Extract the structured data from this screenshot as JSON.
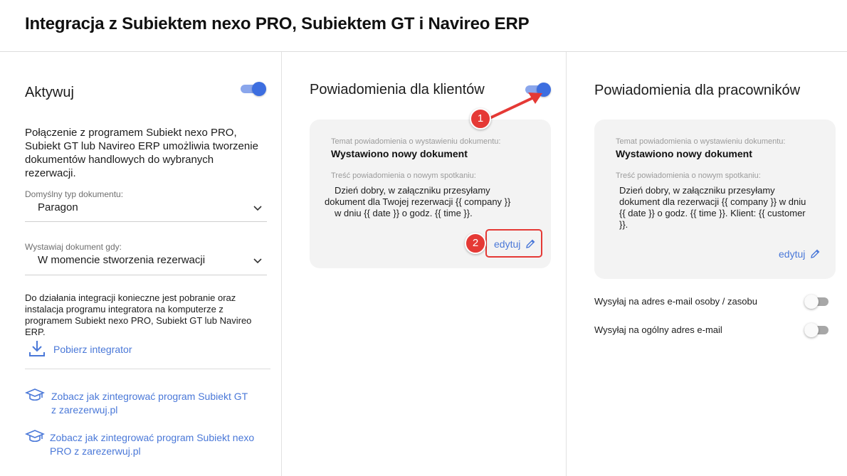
{
  "header": {
    "title": "Integracja z Subiektem nexo PRO, Subiektem GT i Navireo ERP"
  },
  "activate": {
    "title": "Aktywuj",
    "description": "Połączenie z programem Subiekt nexo PRO, Subiekt GT lub Navireo ERP umożliwia tworzenie dokumentów handlowych do wybranych rezerwacji.",
    "doc_type_label": "Domyślny typ dokumentu:",
    "doc_type_value": "Paragon",
    "issue_when_label": "Wystawiaj dokument gdy:",
    "issue_when_value": "W momencie stworzenia rezerwacji",
    "note": "Do działania integracji konieczne jest pobranie oraz instalacja programu integratora na komputerze z programem Subiekt nexo PRO, Subiekt GT lub Navireo ERP.",
    "download_label": "Pobierz integrator",
    "link_gt_line1": "Zobacz jak zintegrować program Subiekt GT",
    "link_gt_line2": "z zarezerwuj.pl",
    "link_nexo_line1": "Zobacz jak zintegrować program Subiekt nexo",
    "link_nexo_line2": "PRO z zarezerwuj.pl"
  },
  "clients": {
    "title": "Powiadomienia dla klientów",
    "subject_label": "Temat powiadomienia o wystawieniu dokumentu:",
    "subject": "Wystawiono nowy dokument",
    "content_label": "Treść powiadomienia o nowym spotkaniu:",
    "content_line1": "Dzień dobry, w załączniku przesyłamy",
    "content_line2": "dokument dla Twojej rezerwacji {{ company }}",
    "content_line3": "w dniu {{ date }} o godz. {{ time }}.",
    "edit_label": "edytuj"
  },
  "employees": {
    "title": "Powiadomienia dla pracowników",
    "subject_label": "Temat powiadomienia o wystawieniu dokumentu:",
    "subject": "Wystawiono nowy dokument",
    "content_label": "Treść powiadomienia o nowym spotkaniu:",
    "content_line1": "Dzień dobry, w załączniku przesyłamy",
    "content_line2": "dokument dla rezerwacji {{ company }} w dniu",
    "content_line3": "{{ date }} o godz. {{ time }}. Klient: {{ customer",
    "content_line4": "}}.",
    "edit_label": "edytuj",
    "opt_person_email": "Wysyłaj na adres e-mail osoby / zasobu",
    "opt_general_email": "Wysyłaj na ogólny adres e-mail"
  },
  "toggles": {
    "activate": true,
    "clients": true,
    "person_email": false,
    "general_email": false
  },
  "annotations": {
    "step1": "1",
    "step2": "2"
  },
  "colors": {
    "accent": "#3d6ee0",
    "link": "#4a78d8",
    "annotation": "#e53935"
  }
}
